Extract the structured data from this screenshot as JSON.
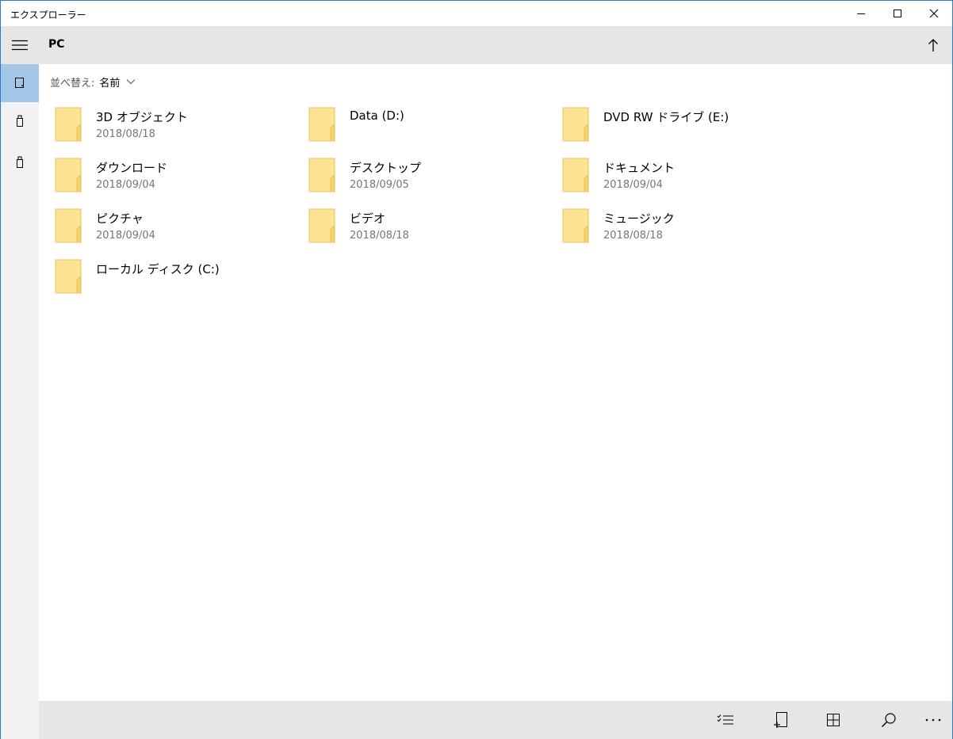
{
  "window": {
    "title": "エクスプローラー"
  },
  "nav": {
    "items": [
      {
        "icon": "pc-icon",
        "active": true
      },
      {
        "icon": "usb-drive-icon",
        "active": false
      },
      {
        "icon": "usb-drive-icon",
        "active": false
      }
    ]
  },
  "header": {
    "location": "PC"
  },
  "sort": {
    "label": "並べ替え:",
    "value": "名前"
  },
  "items": [
    {
      "name": "3D オブジェクト",
      "date": "2018/08/18"
    },
    {
      "name": "Data (D:)",
      "date": ""
    },
    {
      "name": "DVD RW ドライブ (E:)",
      "date": ""
    },
    {
      "name": "ダウンロード",
      "date": "2018/09/04"
    },
    {
      "name": "デスクトップ",
      "date": "2018/09/05"
    },
    {
      "name": "ドキュメント",
      "date": "2018/09/04"
    },
    {
      "name": "ピクチャ",
      "date": "2018/09/04"
    },
    {
      "name": "ビデオ",
      "date": "2018/08/18"
    },
    {
      "name": "ミュージック",
      "date": "2018/08/18"
    },
    {
      "name": "ローカル ディスク (C:)",
      "date": ""
    }
  ],
  "toolbar": {
    "buttons": [
      "select-icon",
      "new-item-icon",
      "view-icon",
      "search-icon",
      "more-icon"
    ]
  },
  "colors": {
    "accent": "#a4c6e6",
    "folder": "#fce494",
    "folder_edge": "#e8c65a",
    "chrome": "#e6e6e6",
    "rail": "#f2f2f2"
  }
}
